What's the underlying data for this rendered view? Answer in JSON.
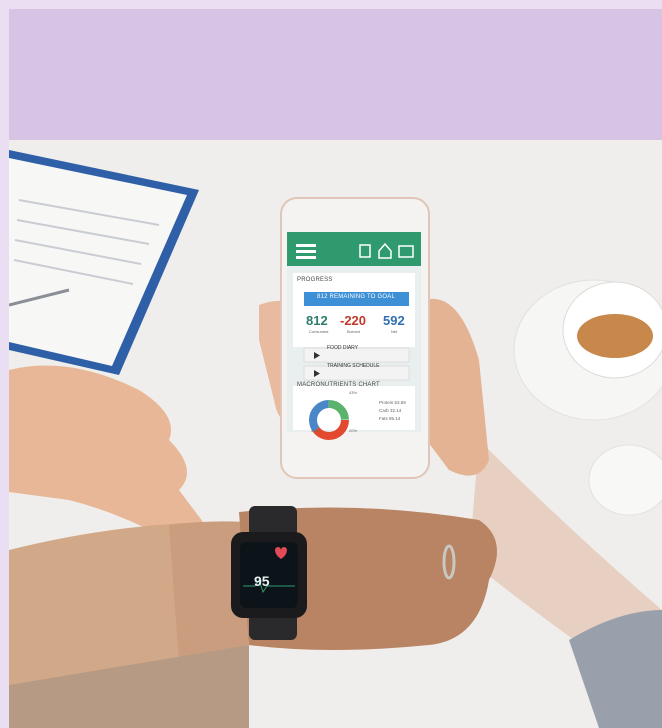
{
  "phone": {
    "section_title": "PROGRESS",
    "banner": "812 REMAINING TO GOAL",
    "stats": [
      {
        "value": "812",
        "label": "Consumed",
        "color": "#2e7d6b"
      },
      {
        "value": "-220",
        "label": "Burned",
        "color": "#c0392b"
      },
      {
        "value": "592",
        "label": "Net",
        "color": "#2f6fb2"
      }
    ],
    "buttons": [
      "FOOD DIARY",
      "TRAINING SCHEDULE"
    ],
    "chart_title": "MACRONUTRIENTS CHART",
    "chart_pct_top": "43%",
    "chart_pct_left": "37%",
    "chart_pct_right": "20%",
    "legend": [
      "Protein 53.59",
      "Carb 32.14",
      "Fats 95.14"
    ]
  },
  "watch": {
    "reading": "95"
  },
  "colors": {
    "accent_green": "#2f9a6d",
    "banner_blue": "#3d8fd6"
  }
}
